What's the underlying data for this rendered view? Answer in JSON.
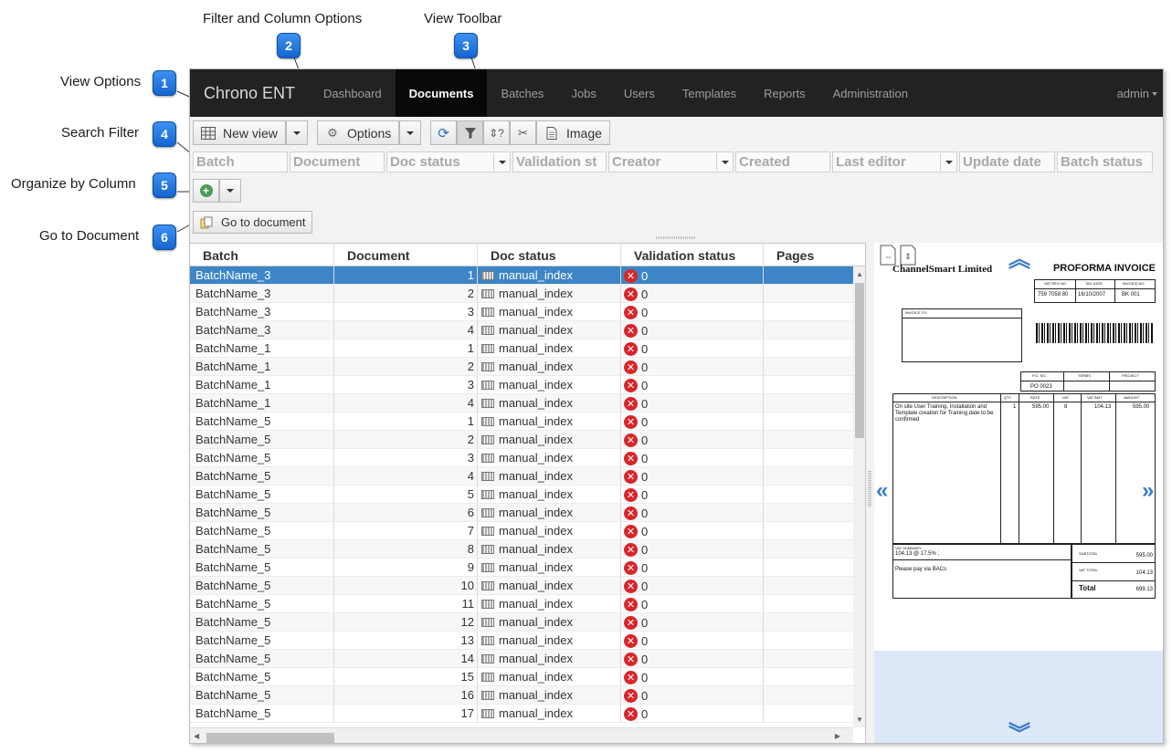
{
  "callouts": [
    {
      "num": "1",
      "label": "View Options"
    },
    {
      "num": "2",
      "label": "Filter and Column Options"
    },
    {
      "num": "3",
      "label": "View Toolbar"
    },
    {
      "num": "4",
      "label": "Search Filter"
    },
    {
      "num": "5",
      "label": "Organize by Column"
    },
    {
      "num": "6",
      "label": "Go to Document"
    }
  ],
  "navbar": {
    "brand": "Chrono ENT",
    "items": [
      "Dashboard",
      "Documents",
      "Batches",
      "Jobs",
      "Users",
      "Templates",
      "Reports",
      "Administration"
    ],
    "active": "Documents",
    "user": "admin"
  },
  "toolbar": {
    "new_view": "New view",
    "options": "Options",
    "image": "Image",
    "go_to_document": "Go to document"
  },
  "filters": [
    "Batch",
    "Document",
    "Doc status",
    "Validation st",
    "Creator",
    "Created",
    "Last editor",
    "Update date",
    "Batch status"
  ],
  "grid": {
    "columns": [
      "Batch",
      "Document",
      "Doc status",
      "Validation status",
      "Pages"
    ],
    "rows": [
      {
        "batch": "BatchName_3",
        "doc": "1",
        "status": "manual_index",
        "validation": "0"
      },
      {
        "batch": "BatchName_3",
        "doc": "2",
        "status": "manual_index",
        "validation": "0"
      },
      {
        "batch": "BatchName_3",
        "doc": "3",
        "status": "manual_index",
        "validation": "0"
      },
      {
        "batch": "BatchName_3",
        "doc": "4",
        "status": "manual_index",
        "validation": "0"
      },
      {
        "batch": "BatchName_1",
        "doc": "1",
        "status": "manual_index",
        "validation": "0"
      },
      {
        "batch": "BatchName_1",
        "doc": "2",
        "status": "manual_index",
        "validation": "0"
      },
      {
        "batch": "BatchName_1",
        "doc": "3",
        "status": "manual_index",
        "validation": "0"
      },
      {
        "batch": "BatchName_1",
        "doc": "4",
        "status": "manual_index",
        "validation": "0"
      },
      {
        "batch": "BatchName_5",
        "doc": "1",
        "status": "manual_index",
        "validation": "0"
      },
      {
        "batch": "BatchName_5",
        "doc": "2",
        "status": "manual_index",
        "validation": "0"
      },
      {
        "batch": "BatchName_5",
        "doc": "3",
        "status": "manual_index",
        "validation": "0"
      },
      {
        "batch": "BatchName_5",
        "doc": "4",
        "status": "manual_index",
        "validation": "0"
      },
      {
        "batch": "BatchName_5",
        "doc": "5",
        "status": "manual_index",
        "validation": "0"
      },
      {
        "batch": "BatchName_5",
        "doc": "6",
        "status": "manual_index",
        "validation": "0"
      },
      {
        "batch": "BatchName_5",
        "doc": "7",
        "status": "manual_index",
        "validation": "0"
      },
      {
        "batch": "BatchName_5",
        "doc": "8",
        "status": "manual_index",
        "validation": "0"
      },
      {
        "batch": "BatchName_5",
        "doc": "9",
        "status": "manual_index",
        "validation": "0"
      },
      {
        "batch": "BatchName_5",
        "doc": "10",
        "status": "manual_index",
        "validation": "0"
      },
      {
        "batch": "BatchName_5",
        "doc": "11",
        "status": "manual_index",
        "validation": "0"
      },
      {
        "batch": "BatchName_5",
        "doc": "12",
        "status": "manual_index",
        "validation": "0"
      },
      {
        "batch": "BatchName_5",
        "doc": "13",
        "status": "manual_index",
        "validation": "0"
      },
      {
        "batch": "BatchName_5",
        "doc": "14",
        "status": "manual_index",
        "validation": "0"
      },
      {
        "batch": "BatchName_5",
        "doc": "15",
        "status": "manual_index",
        "validation": "0"
      },
      {
        "batch": "BatchName_5",
        "doc": "16",
        "status": "manual_index",
        "validation": "0"
      },
      {
        "batch": "BatchName_5",
        "doc": "17",
        "status": "manual_index",
        "validation": "0"
      }
    ]
  },
  "preview": {
    "company": "ChannelSmart Limited",
    "title": "PROFORMA INVOICE",
    "vat_reg_no": "759 7058 80",
    "tax_date": "16/10/2007",
    "invoice_no": "BK 001",
    "invoice_to": "INVOICE TO:",
    "po_no": "PO 0023",
    "line_desc": "On site User Training, Installation and Template creation for Training date to be confirmed",
    "qty": "1",
    "rate": "595.00",
    "vat": "8",
    "vat_amt": "104.13",
    "amount": "595.00",
    "vat_summary": "104.13 @ 17.5% ;",
    "pay_note": "Please pay via BACs",
    "subtotal": "595.00",
    "vat_total": "104.13",
    "total": "699.13",
    "labels": {
      "vat_reg": "VAT REG NO",
      "tax": "TAX DATE",
      "inv": "INVOICE NO",
      "po": "P.O. NO.",
      "terms": "TERMS",
      "project": "PROJECT",
      "description": "DESCRIPTION",
      "qty": "QTY",
      "rate": "RATE",
      "vat": "VAT",
      "vat_amt": "VAT AMT",
      "amount": "AMOUNT",
      "vat_summary": "VAT SUMMARY:",
      "subtotal": "SUBTOTAL",
      "vat_total": "VAT TOTAL",
      "total": "Total"
    }
  },
  "colors": {
    "accent": "#1a6fd6",
    "selected_row": "#3d85c6",
    "navbar": "#222222",
    "error": "#d9252a"
  }
}
